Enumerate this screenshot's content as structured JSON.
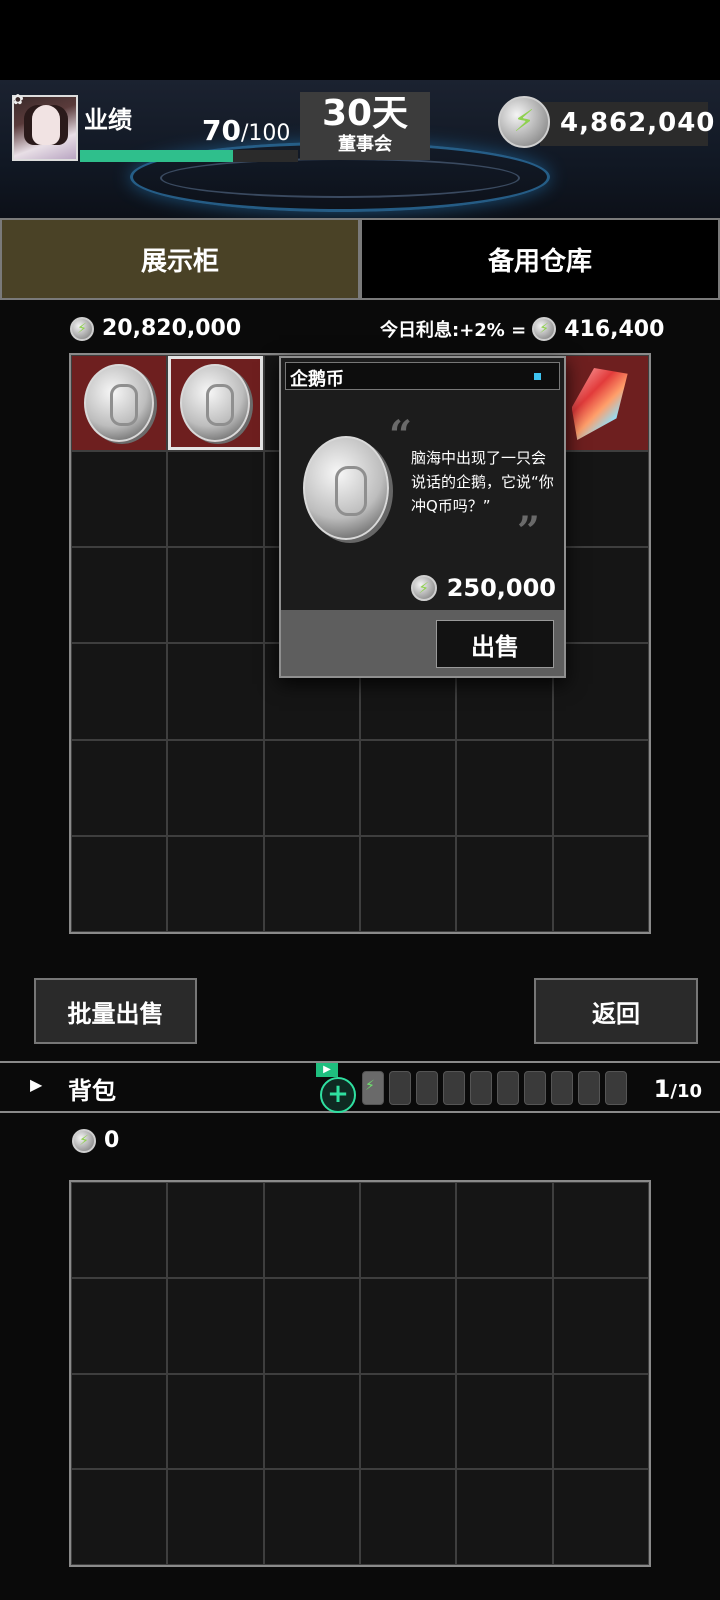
{
  "header": {
    "performance_label": "业绩",
    "performance_current": "70",
    "performance_max": "/100",
    "performance_progress": 0.7,
    "days": "30天",
    "days_subtitle": "董事会",
    "money": "4,862,040"
  },
  "tabs": [
    {
      "label": "展示柜",
      "active": true
    },
    {
      "label": "备用仓库",
      "active": false
    }
  ],
  "showcase": {
    "total_value": "20,820,000",
    "interest_label": "今日利息:+2% =",
    "interest_value": "416,400"
  },
  "popup": {
    "title": "企鹅币",
    "description": "脑海中出现了一只会说话的企鹅，它说“你冲Q币吗？”",
    "price": "250,000",
    "sell_label": "出售"
  },
  "actions": {
    "bulk_sell_label": "批量出售",
    "back_label": "返回"
  },
  "backpack": {
    "label": "背包",
    "ad_icon": "▶",
    "capacity_current": "1",
    "capacity_max": "/10",
    "money": "0"
  },
  "icons": {
    "settings": "gear-icon",
    "currency": "lightning-coin-icon",
    "expand": "triangle-right-icon",
    "add": "plus-icon",
    "battery": "battery-icon"
  },
  "colors": {
    "accent_green": "#2fbf8c",
    "active_tab": "#4a4226",
    "occupied_cell": "#6e1f1f"
  }
}
